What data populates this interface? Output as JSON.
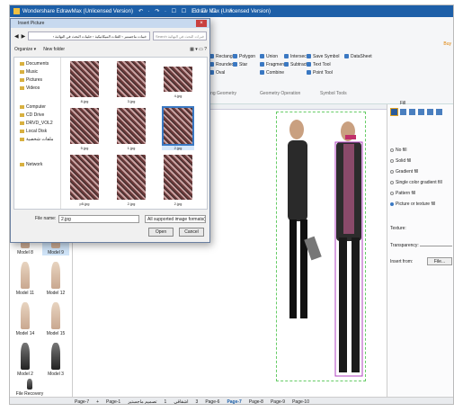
{
  "app": {
    "title": "Wondershare EdrawMax (Unlicensed Version)",
    "window_title": "Edraw Max (Unlicensed Version)",
    "quick_access": "↶ · ↷ · ☐ ☐ ☐ ☐ ☐ · ↗ ·"
  },
  "ribbon": {
    "page_link": "Buy",
    "groups": [
      {
        "label": "ing Geometry",
        "items": [
          "Rectangle",
          "Rounded",
          "Oval"
        ],
        "items2": [
          "Polygon",
          "Star"
        ]
      },
      {
        "label": "Geometry Operation",
        "items": [
          "Union",
          "Fragment",
          "Combine"
        ],
        "items2": [
          "Intersect",
          "Subtract"
        ]
      },
      {
        "label": "Symbol Tools",
        "items": [
          "Save Symbol",
          "Text Tool",
          "Point Tool"
        ],
        "items2": [
          "DataSheet"
        ]
      }
    ]
  },
  "library": {
    "items": [
      {
        "label": "Model 8"
      },
      {
        "label": "Model 9"
      },
      {
        "label": "Model 11"
      },
      {
        "label": "Model 12"
      },
      {
        "label": "Model 14"
      },
      {
        "label": "Model 15"
      },
      {
        "label": "Model 2"
      },
      {
        "label": "Model 3"
      },
      {
        "label": "File Recovery"
      }
    ]
  },
  "right_panel": {
    "header": "Fill",
    "options": [
      "No fill",
      "Solid fill",
      "Gradient fill",
      "Single color gradient fill",
      "Pattern fill",
      "Picture or texture fill"
    ],
    "texture_label": "Texture:",
    "transparency_label": "Transparency:",
    "insert_from_label": "Insert from:",
    "file_button": "File..."
  },
  "status": {
    "page_label": "Page-7",
    "tabs": [
      "Page-1",
      "تصميم ماجستير",
      "1",
      "اشقاقي",
      "3",
      "Page-6",
      "Page-7",
      "Page-8",
      "Page-9",
      "Page-10"
    ],
    "active_tab": "Page-7"
  },
  "dialog": {
    "title": "Insert Picture",
    "address": "› خيبات ماجستير › الفئات الميكانيكية › حليبات البحث في النهائية",
    "search_placeholder": "Search خبرات البحث في النهائية",
    "organize": "Organize ▾",
    "new_folder": "New folder",
    "nav": [
      "Documents",
      "Music",
      "Pictures",
      "Videos",
      "Computer",
      "CD Drive",
      "DRVD_VOL2",
      "Local Disk",
      "ملفات شخصية",
      "Network"
    ],
    "thumbs": [
      {
        "name": "8.jpg"
      },
      {
        "name": "3.jpg"
      },
      {
        "name": "4.jpg"
      },
      {
        "name": "5.jpg"
      },
      {
        "name": "1.jpg"
      },
      {
        "name": "2.jpg"
      },
      {
        "name": "p5.jpg"
      },
      {
        "name": "2.jpg"
      },
      {
        "name": "2.jpg"
      }
    ],
    "file_name_label": "File name:",
    "file_name_value": "2.jpg",
    "file_type_value": "All supported image formats(*.",
    "open": "Open",
    "cancel": "Cancel"
  }
}
